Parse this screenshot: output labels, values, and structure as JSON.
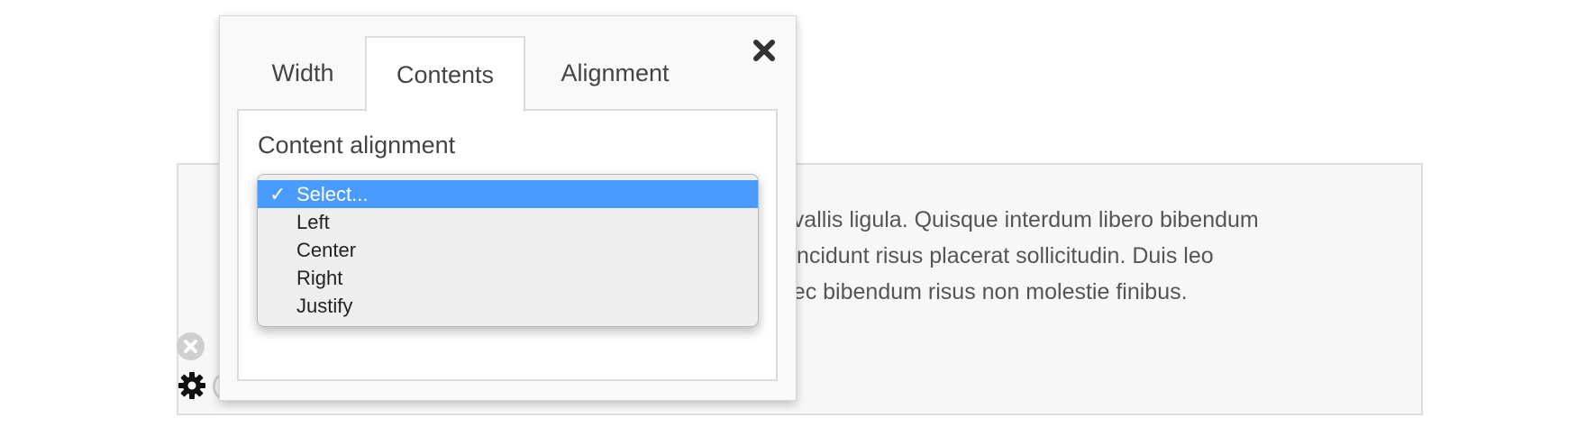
{
  "content": {
    "text": "onvallis ligula. Quisque interdum libero bibendum\nc tincidunt risus placerat sollicitudin. Duis leo\nonec bibendum risus non molestie finibus."
  },
  "popup": {
    "tabs": [
      {
        "label": "Width"
      },
      {
        "label": "Contents",
        "active": true
      },
      {
        "label": "Alignment"
      }
    ],
    "panel": {
      "field_label": "Content alignment",
      "dropdown": {
        "selected": "Select...",
        "check_mark": "✓",
        "options": [
          {
            "label": "Select...",
            "selected": true
          },
          {
            "label": "Left"
          },
          {
            "label": "Center"
          },
          {
            "label": "Right"
          },
          {
            "label": "Justify"
          }
        ]
      }
    }
  },
  "icons": {
    "close": "close-icon",
    "remove": "remove-icon",
    "settings": "gear-icon"
  },
  "colors": {
    "highlight": "#4a9bff",
    "panel_border": "#dcdcdc",
    "content_bg": "#f7f7f7"
  }
}
